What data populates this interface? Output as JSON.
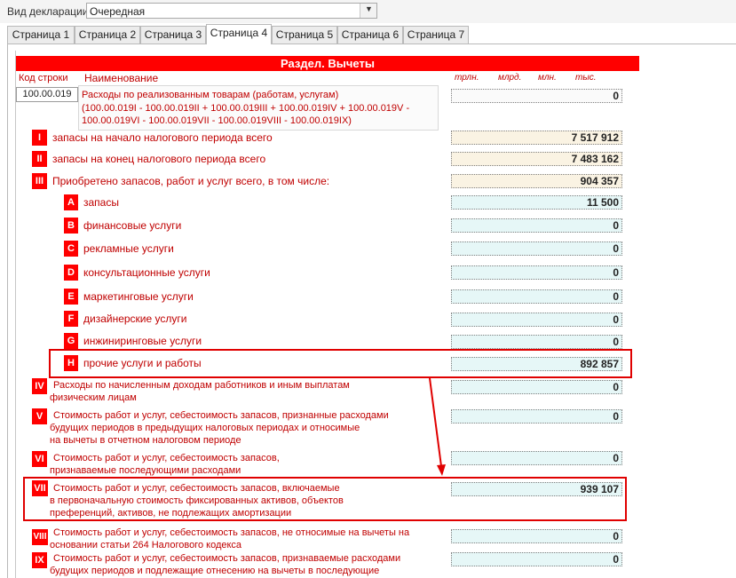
{
  "header": {
    "decl_label": "Вид декларации:",
    "decl_value": "Очередная"
  },
  "tabs": [
    {
      "label": "Страница 1"
    },
    {
      "label": "Страница 2"
    },
    {
      "label": "Страница 3"
    },
    {
      "label": "Страница 4"
    },
    {
      "label": "Страница 5"
    },
    {
      "label": "Страница 6"
    },
    {
      "label": "Страница 7"
    }
  ],
  "active_tab": "Страница 4",
  "section": {
    "title": "Раздел. Вычеты"
  },
  "columns": {
    "code": "Код строки",
    "name": "Наименование",
    "units": [
      "трлн.",
      "млрд.",
      "млн.",
      "тыс."
    ]
  },
  "main_row": {
    "code": "100.00.019",
    "lines": [
      "Расходы по реализованным товарам (работам, услугам)",
      "(100.00.019I - 100.00.019II + 100.00.019III + 100.00.019IV + 100.00.019V -",
      "100.00.019VI - 100.00.019VII - 100.00.019VIII - 100.00.019IX)"
    ],
    "value": "0"
  },
  "rows": [
    {
      "badge": "I",
      "lines": [
        "запасы на начало налогового периода всего"
      ],
      "value": "7 517 912"
    },
    {
      "badge": "II",
      "lines": [
        "запасы на конец налогового периода всего"
      ],
      "value": "7 483 162"
    },
    {
      "badge": "III",
      "lines": [
        "Приобретено запасов, работ и услуг всего,  в том числе:"
      ],
      "value": "904 357"
    },
    {
      "badge": "A",
      "lines": [
        "запасы"
      ],
      "value": "11 500"
    },
    {
      "badge": "B",
      "lines": [
        "финансовые услуги"
      ],
      "value": "0"
    },
    {
      "badge": "C",
      "lines": [
        "рекламные услуги"
      ],
      "value": "0"
    },
    {
      "badge": "D",
      "lines": [
        "консультационные услуги"
      ],
      "value": "0"
    },
    {
      "badge": "E",
      "lines": [
        "маркетинговые услуги"
      ],
      "value": "0"
    },
    {
      "badge": "F",
      "lines": [
        "дизайнерские услуги"
      ],
      "value": "0"
    },
    {
      "badge": "G",
      "lines": [
        "инжиниринговые услуги"
      ],
      "value": "0"
    },
    {
      "badge": "H",
      "lines": [
        "прочие услуги и работы"
      ],
      "value": "892 857"
    },
    {
      "badge": "IV",
      "lines": [
        "Расходы по начисленным доходам работников и иным выплатам",
        "физическим лицам"
      ],
      "value": "0"
    },
    {
      "badge": "V",
      "lines": [
        "Стоимость работ и услуг, себестоимость запасов, признанные расходами",
        "будущих периодов в предыдущих налоговых периодах и относимые",
        "на вычеты в отчетном налоговом периоде"
      ],
      "value": "0"
    },
    {
      "badge": "VI",
      "lines": [
        "Стоимость работ и услуг, себестоимость запасов,",
        "признаваемые последующими расходами"
      ],
      "value": "0"
    },
    {
      "badge": "VII",
      "lines": [
        "Стоимость работ и услуг, себестоимость запасов, включаемые",
        "в первоначальную стоимость фиксированных активов, объектов",
        "преференций, активов, не подлежащих амортизации"
      ],
      "value": "939 107"
    },
    {
      "badge": "VIII",
      "lines": [
        "Стоимость работ и услуг, себестоимость запасов, не относимые на вычеты на",
        "основании статьи 264 Налогового кодекса"
      ],
      "value": "0"
    },
    {
      "badge": "IX",
      "lines": [
        "Стоимость работ и услуг, себестоимость запасов, признаваемые расходами",
        "будущих периодов и подлежащие отнесению на вычеты в последующие"
      ],
      "value": "0"
    }
  ],
  "colors": {
    "accent": "#ff0000",
    "field_blue": "#e6f7f7",
    "field_tan": "#faf3e3"
  }
}
